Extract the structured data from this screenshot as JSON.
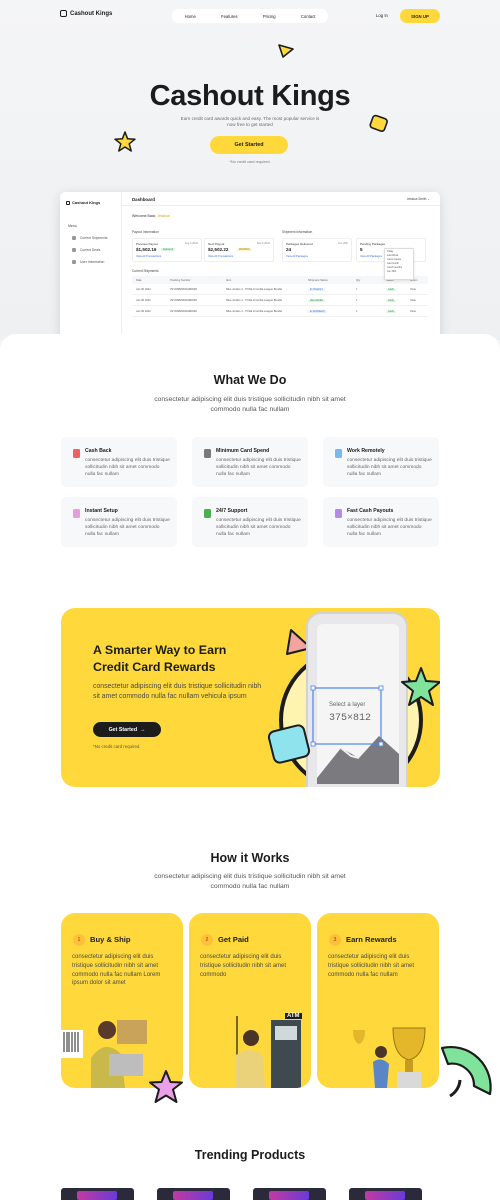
{
  "nav": {
    "brand": "Cashout Kings",
    "links": [
      "Home",
      "Features",
      "Pricing",
      "Contact"
    ],
    "login": "Log In",
    "signup": "SIGN UP"
  },
  "hero": {
    "title": "Cashout Kings",
    "subtitle": "Earn credit card awards quick and easy. The most popular service is now free to get started",
    "cta": "Get Started",
    "note": "*No credit card required."
  },
  "dashboard": {
    "brand": "Cashout Kings",
    "menu_label": "Menu",
    "menu_items": [
      "Current Shipments",
      "Current Deals",
      "User Information"
    ],
    "title": "Dashboard",
    "user": "Jessica Smith",
    "welcome_prefix": "Welcome Back,",
    "welcome_name": "Jessica!",
    "payout_label": "Payout Information",
    "shipment_label": "Shipment Information",
    "cards": [
      {
        "label": "Previous Payout",
        "date": "Aug 4 2022",
        "amount": "$1,502.16",
        "badge": "Delivered",
        "link": "View All Transactions"
      },
      {
        "label": "Next Payout",
        "date": "Sep 4 2022",
        "amount": "$2,502.22",
        "badge": "PENDING",
        "link": "View All Transactions"
      },
      {
        "label": "Packages Delivered",
        "date": "Jun 30th",
        "amount": "24",
        "link": "View All Packages"
      },
      {
        "label": "Pending Packages",
        "date": "",
        "amount": "5",
        "link": "View All Packages"
      }
    ],
    "dropdown": [
      "Today",
      "Last Week",
      "Last 2 weeks",
      "Last month",
      "Last 6 months",
      "Jun 30th"
    ],
    "table_label": "Current Shipments",
    "columns": [
      "Date",
      "Tracking Number",
      "Item",
      "Shipment Status",
      "Qty",
      "Status",
      "Action"
    ],
    "rows": [
      [
        "Jan 30 2022",
        "7EYD9826DDH9D028",
        "Nike Jordan 4 - Thrilla & Gorilla League Bundle",
        "IN TRANSIT",
        "1",
        "SAVE",
        "View"
      ],
      [
        "Jan 30 2022",
        "7EYD9826DDH9D028",
        "Nike Jordan 4 - Thrilla & Gorilla League Bundle",
        "DELIVERED",
        "1",
        "SAVE",
        "View"
      ],
      [
        "Jan 30 2022",
        "7EYD9826DDH9D028",
        "Nike Jordan 4 - Thrilla & Gorilla League Bundle",
        "IN SHIPMENT",
        "1",
        "SAVE",
        "View"
      ]
    ]
  },
  "what_we_do": {
    "title": "What We Do",
    "subtitle": "consectetur adipiscing elit duis tristique sollicitudin nibh sit amet commodo nulla fac nullam",
    "features": [
      {
        "title": "Cash Back",
        "desc": "consectetur adipiscing elit duis tristique sollicitudin nibh sit amet commodo nulla fac nullam",
        "color": "#f0605c",
        "icon": "cash-icon"
      },
      {
        "title": "Minimum Card Spend",
        "desc": "consectetur adipiscing elit duis tristique sollicitudin nibh sit amet commodo nulla fac nullam",
        "color": "#7a7a7a",
        "icon": "card-icon"
      },
      {
        "title": "Work Remotely",
        "desc": "consectetur adipiscing elit duis tristique sollicitudin nibh sit amet commodo nulla fac nullam",
        "color": "#7ab8f0",
        "icon": "remote-icon"
      },
      {
        "title": "Instant Setup",
        "desc": "consectetur adipiscing elit duis tristique sollicitudin nibh sit amet commodo nulla fac nullam",
        "color": "#e99be0",
        "icon": "setup-icon"
      },
      {
        "title": "24/7 Support",
        "desc": "consectetur adipiscing elit duis tristique sollicitudin nibh sit amet commodo nulla fac nullam",
        "color": "#4caf50",
        "icon": "support-icon"
      },
      {
        "title": "Fast Cash Payouts",
        "desc": "consectetur adipiscing elit duis tristique sollicitudin nibh sit amet commodo nulla fac nullam",
        "color": "#b48ae8",
        "icon": "payout-icon"
      }
    ]
  },
  "banner": {
    "title": "A Smarter Way to Earn Credit Card Rewards",
    "desc": "consectetur adipiscing elit duis tristique sollicitudin nibh sit amet commodo nulla fac nullam vehicula ipsum",
    "cta": "Get Started",
    "note": "*No credit card required.",
    "phone_caption": "Select a layer",
    "phone_size": "375×812"
  },
  "how_it_works": {
    "title": "How it Works",
    "subtitle": "consectetur adipiscing elit duis tristique sollicitudin nibh sit amet commodo nulla fac nullam",
    "steps": [
      {
        "num": "1",
        "title": "Buy & Ship",
        "desc": "consectetur adipiscing elit duis tristique sollicitudin nibh sit amet commodo nulla fac nullam Lorem ipsum dolor sit amet"
      },
      {
        "num": "2",
        "title": "Get Paid",
        "desc": "consectetur adipiscing elit duis tristique sollicitudin nibh sit amet commodo"
      },
      {
        "num": "3",
        "title": "Earn Rewards",
        "desc": "consectetur adipiscing elit duis tristique sollicitudin nibh sit amet commodo nulla fac nullam"
      }
    ],
    "atm_label": "ATM"
  },
  "trending": {
    "title": "Trending Products"
  },
  "colors": {
    "accent": "#ffd93b",
    "dark": "#1c1c1c"
  }
}
